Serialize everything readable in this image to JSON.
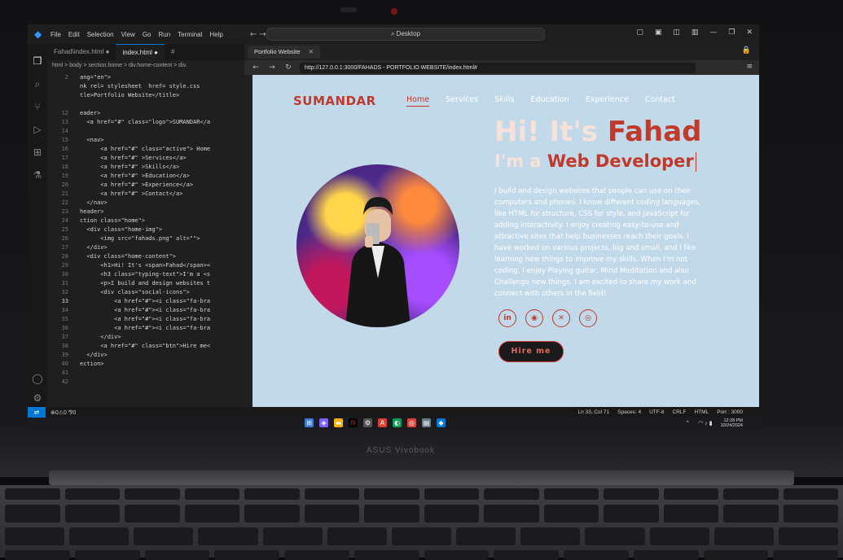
{
  "device": {
    "brand": "ASUS Vivobook"
  },
  "vscode": {
    "menu": [
      "File",
      "Edit",
      "Selection",
      "View",
      "Go",
      "Run",
      "Terminal",
      "Help"
    ],
    "command_center": "Desktop",
    "tabs": [
      {
        "label": "Fahad\\index.html",
        "dirty": true,
        "active": false
      },
      {
        "label": "index.html",
        "dirty": true,
        "active": true
      },
      {
        "label": "#",
        "active": false
      }
    ],
    "breadcrumbs": "html > body > section.home > div.home-content > div.",
    "lines": [
      {
        "n": "2",
        "code": "ang=\"en\">"
      },
      {
        "n": "",
        "code": "nk rel= stylesheet  href= style.css"
      },
      {
        "n": "",
        "code": "tle>Portfolio Website</title>"
      },
      {
        "n": "",
        "code": ""
      },
      {
        "n": "12",
        "code": "eader>"
      },
      {
        "n": "13",
        "code": "  <a href=\"#\" class=\"logo\">SUMANDAR</a"
      },
      {
        "n": "14",
        "code": ""
      },
      {
        "n": "15",
        "code": "  <nav>"
      },
      {
        "n": "16",
        "code": "      <a href=\"#\" class=\"active\"> Home"
      },
      {
        "n": "17",
        "code": "      <a href=\"#\" >Services</a>"
      },
      {
        "n": "18",
        "code": "      <a href=\"#\" >Skills</a>"
      },
      {
        "n": "19",
        "code": "      <a href=\"#\" >Education</a>"
      },
      {
        "n": "20",
        "code": "      <a href=\"#\" >Experience</a>"
      },
      {
        "n": "21",
        "code": "      <a href=\"#\" >Contact</a>"
      },
      {
        "n": "22",
        "code": "  </nav>"
      },
      {
        "n": "23",
        "code": "header>"
      },
      {
        "n": "24",
        "code": "ction class=\"home\">"
      },
      {
        "n": "25",
        "code": "  <div class=\"home-img\">"
      },
      {
        "n": "26",
        "code": "      <img src=\"fahads.png\" alt=\"\">"
      },
      {
        "n": "27",
        "code": "  </div>"
      },
      {
        "n": "28",
        "code": "  <div class=\"home-content\">"
      },
      {
        "n": "29",
        "code": "      <h1>Hi! It's <span>Fahad</span><"
      },
      {
        "n": "30",
        "code": "      <h3 class=\"typing-text\">I'm a <s"
      },
      {
        "n": "31",
        "code": "      <p>I build and design websites t"
      },
      {
        "n": "32",
        "code": "      <div class=\"social-icons\">"
      },
      {
        "n": "33",
        "code": "          <a href=\"#\"><i class=\"fa-bra"
      },
      {
        "n": "34",
        "code": "          <a href=\"#\"><i class=\"fa-bra"
      },
      {
        "n": "35",
        "code": "          <a href=\"#\"><i class=\"fa-bra"
      },
      {
        "n": "36",
        "code": "          <a href=\"#\"><i class=\"fa-bra"
      },
      {
        "n": "37",
        "code": "      </div>"
      },
      {
        "n": "38",
        "code": "      <a href=\"#\" class=\"btn\">Hire me<"
      },
      {
        "n": "39",
        "code": "  </div>"
      },
      {
        "n": "40",
        "code": "ection>"
      },
      {
        "n": "41",
        "code": ""
      },
      {
        "n": "42",
        "code": ""
      }
    ],
    "statusbar": {
      "left": "⊗0⚠0  ⅋0",
      "items": [
        "Ln 33, Col 71",
        "Spaces: 4",
        "UTF-8",
        "CRLF",
        "HTML",
        "Port : 3000"
      ]
    }
  },
  "browser": {
    "tab_label": "Portfolio Website",
    "url": "http://127.0.0.1:3000/FAHADS - PORTFOLIO WEBSITE/index.html#"
  },
  "site": {
    "logo": "SUMANDAR",
    "nav": [
      "Home",
      "Services",
      "Skills",
      "Education",
      "Experience",
      "Contact"
    ],
    "active_nav": "Home",
    "h1_prefix": "Hi! It's ",
    "h1_name": "Fahad",
    "h3_prefix": "I'm a ",
    "h3_role": "Web Developer",
    "bio": "I build and design websites that people can use on their computers and phones. I know different coding languages, like HTML for structure, CSS for style, and JavaScript for adding interactivity. I enjoy creating easy-to-use and attractive sites that help businesses reach their goals. I have worked on various projects, big and small, and I like learning new things to improve my skills. When I'm not coding, I enjoy Playing guitar, Mind Meditation and also Challenge new things. I am excited to share my work and connect with others in the field!",
    "socials": [
      "linkedin-icon",
      "github-icon",
      "x-icon",
      "instagram-icon"
    ],
    "hire_label": "Hire me",
    "colors": {
      "accent": "#c0392b",
      "background": "#c2d9ea",
      "heading": "#f6e2da"
    }
  },
  "taskbar": {
    "time": "12:28 PM",
    "date": "10/24/2024"
  }
}
